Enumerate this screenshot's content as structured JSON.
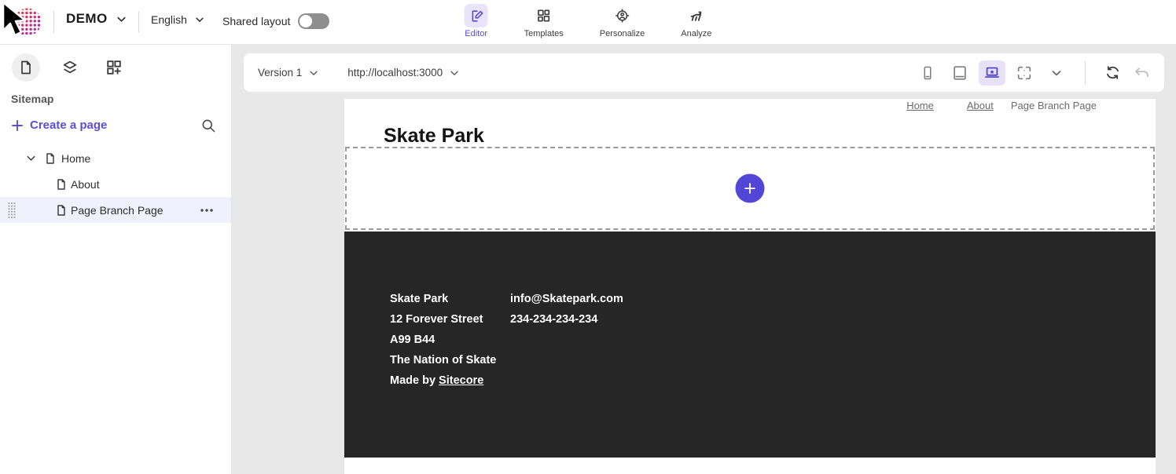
{
  "topbar": {
    "site_name": "DEMO",
    "language": "English",
    "shared_layout_label": "Shared layout",
    "shared_layout_state": "off",
    "tabs": [
      {
        "label": "Editor",
        "icon": "editor-icon",
        "active": true
      },
      {
        "label": "Templates",
        "icon": "templates-icon",
        "active": false
      },
      {
        "label": "Personalize",
        "icon": "personalize-icon",
        "active": false
      },
      {
        "label": "Analyze",
        "icon": "analyze-icon",
        "active": false
      }
    ]
  },
  "sidebar": {
    "panel_title": "Sitemap",
    "create_page_label": "Create a page",
    "tree": [
      {
        "label": "Home",
        "level": 0,
        "expanded": true,
        "selected": false
      },
      {
        "label": "About",
        "level": 1,
        "expanded": false,
        "selected": false
      },
      {
        "label": "Page Branch Page",
        "level": 1,
        "expanded": false,
        "selected": true
      }
    ]
  },
  "toolbar": {
    "version_label": "Version 1",
    "site_url": "http://localhost:3000",
    "active_device": "desktop"
  },
  "canvas": {
    "nav": [
      {
        "label": "Home",
        "link": true
      },
      {
        "label": "About",
        "link": true
      },
      {
        "label": "Page Branch Page",
        "link": false
      }
    ],
    "page_title": "Skate Park",
    "footer": {
      "address_lines": [
        "Skate Park",
        "12 Forever Street",
        "A99 B44",
        "The Nation of Skate"
      ],
      "made_by_prefix": "Made by ",
      "made_by_link": "Sitecore",
      "contact_lines": [
        "info@Skatepark.com",
        "234-234-234-234"
      ]
    }
  },
  "icons": {
    "logo": "sitecore-dotted-circle",
    "navigation": [
      "chevron-down",
      "search",
      "plus",
      "drag-handle",
      "more-horizontal"
    ],
    "top_tabs": [
      "editor",
      "templates",
      "personalize",
      "analyze"
    ],
    "sidebar_panels": [
      "pages",
      "layers",
      "components"
    ],
    "device_preview": [
      "phone",
      "tablet",
      "laptop-star",
      "fit-screen",
      "chevron-down"
    ],
    "toolbar_actions": [
      "refresh",
      "undo"
    ],
    "overlay": "mouse-cursor"
  },
  "colors": {
    "accent": "#5246d6",
    "accent_bg": "#e9e4fb",
    "selected_row_bg": "#eff1fc",
    "workspace_bg": "#e8e8e8",
    "footer_bg": "#262626",
    "muted_text": "#6b6b6b"
  }
}
